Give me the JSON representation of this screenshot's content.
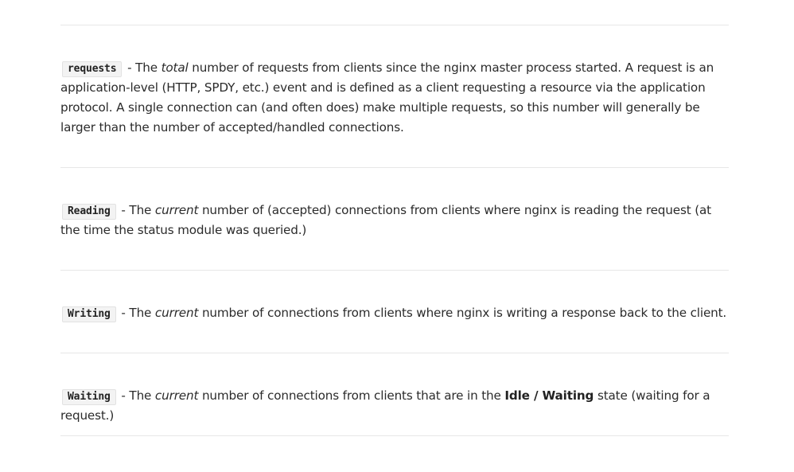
{
  "entries": [
    {
      "term": "requests",
      "text_1": " - The ",
      "em": "total",
      "text_2": " number of requests from clients since the nginx master process started. A request is an application-level (HTTP, SPDY, etc.) event and is defined as a client requesting a resource via the application protocol. A single connection can (and often does) make multiple requests, so this number will generally be larger than the number of accepted/handled connections."
    },
    {
      "term": "Reading",
      "text_1": " - The ",
      "em": "current",
      "text_2": " number of (accepted) connections from clients where nginx is reading the request (at the time the status module was queried.)"
    },
    {
      "term": "Writing",
      "text_1": " - The ",
      "em": "current",
      "text_2": " number of connections from clients where nginx is writing a response back to the client."
    },
    {
      "term": "Waiting",
      "text_1": " - The ",
      "em": "current",
      "text_2": " number of connections from clients that are in the ",
      "strong": "Idle / Waiting",
      "text_3": " state (waiting for a request.)"
    }
  ]
}
